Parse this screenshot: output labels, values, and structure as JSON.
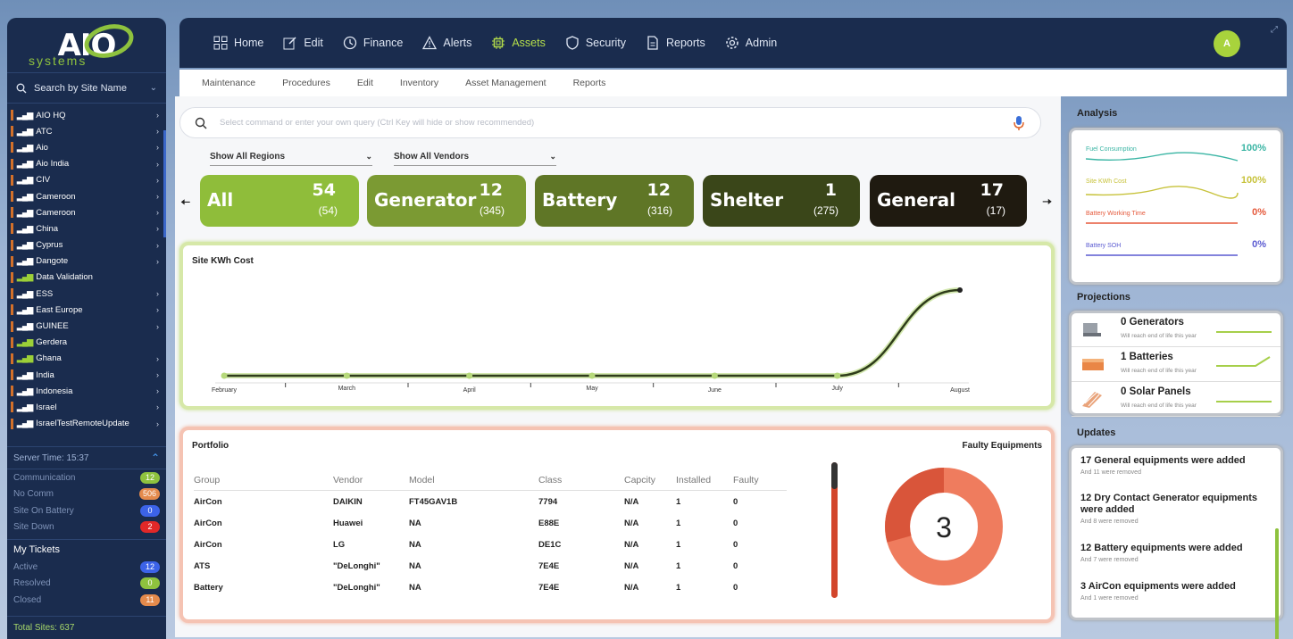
{
  "logo": {
    "brand": "AIO",
    "sub": "systems"
  },
  "sidebar": {
    "search_label": "Search by Site Name",
    "sites": [
      {
        "name": "AIO HQ",
        "arrow": true,
        "green": false
      },
      {
        "name": "ATC",
        "arrow": true,
        "green": false
      },
      {
        "name": "Aio",
        "arrow": true,
        "green": false
      },
      {
        "name": "Aio India",
        "arrow": true,
        "green": false
      },
      {
        "name": "CIV",
        "arrow": true,
        "green": false
      },
      {
        "name": "Cameroon",
        "arrow": true,
        "green": false
      },
      {
        "name": "Cameroon",
        "arrow": true,
        "green": false
      },
      {
        "name": "China",
        "arrow": true,
        "green": false
      },
      {
        "name": "Cyprus",
        "arrow": true,
        "green": false
      },
      {
        "name": "Dangote",
        "arrow": true,
        "green": false
      },
      {
        "name": "Data Validation",
        "arrow": false,
        "green": true
      },
      {
        "name": "ESS",
        "arrow": true,
        "green": false
      },
      {
        "name": "East Europe",
        "arrow": true,
        "green": false
      },
      {
        "name": "GUINEE",
        "arrow": true,
        "green": false
      },
      {
        "name": "Gerdera",
        "arrow": false,
        "green": true
      },
      {
        "name": "Ghana",
        "arrow": true,
        "green": true
      },
      {
        "name": "India",
        "arrow": true,
        "green": false
      },
      {
        "name": "Indonesia",
        "arrow": true,
        "green": false
      },
      {
        "name": "Israel",
        "arrow": true,
        "green": false
      },
      {
        "name": "IsraelTestRemoteUpdate",
        "arrow": true,
        "green": false
      }
    ],
    "server_time": "Server Time: 15:37",
    "stats": [
      {
        "label": "Communication",
        "value": "12",
        "color": "green"
      },
      {
        "label": "No Comm",
        "value": "506",
        "color": "orange"
      },
      {
        "label": "Site On Battery",
        "value": "0",
        "color": "blue"
      },
      {
        "label": "Site Down",
        "value": "2",
        "color": "red"
      }
    ],
    "tickets_heading": "My Tickets",
    "tickets": [
      {
        "label": "Active",
        "value": "12",
        "color": "blue"
      },
      {
        "label": "Resolved",
        "value": "0",
        "color": "green"
      },
      {
        "label": "Closed",
        "value": "11",
        "color": "orange"
      }
    ],
    "total_sites": "Total Sites: 637"
  },
  "nav": {
    "items": [
      {
        "label": "Home",
        "icon": "grid-icon"
      },
      {
        "label": "Edit",
        "icon": "edit-icon"
      },
      {
        "label": "Finance",
        "icon": "clock-icon"
      },
      {
        "label": "Alerts",
        "icon": "warning-icon"
      },
      {
        "label": "Assets",
        "icon": "chip-icon",
        "active": true
      },
      {
        "label": "Security",
        "icon": "shield-icon"
      },
      {
        "label": "Reports",
        "icon": "document-icon"
      },
      {
        "label": "Admin",
        "icon": "gear-icon"
      }
    ],
    "avatar": "A",
    "subtabs": [
      "Maintenance",
      "Procedures",
      "Edit",
      "Inventory",
      "Asset Management",
      "Reports"
    ]
  },
  "command": {
    "placeholder": "Select command or enter your own query (Ctrl Key will hide or show recommended)"
  },
  "filters": {
    "regions": "Show All Regions",
    "vendors": "Show All Vendors"
  },
  "cards": [
    {
      "name": "All",
      "count": "54",
      "sub": "(54)",
      "color": "#8fbd3a"
    },
    {
      "name": "Generator",
      "count": "12",
      "sub": "(345)",
      "color": "#7b9a33"
    },
    {
      "name": "Battery",
      "count": "12",
      "sub": "(316)",
      "color": "#5f7626"
    },
    {
      "name": "Shelter",
      "count": "1",
      "sub": "(275)",
      "color": "#3a4619"
    },
    {
      "name": "General",
      "count": "17",
      "sub": "(17)",
      "color": "#1f1a10"
    }
  ],
  "chart": {
    "title": "Site KWh Cost",
    "x_labels": [
      "February",
      "March",
      "April",
      "May",
      "June",
      "July",
      "August"
    ]
  },
  "chart_data": {
    "type": "line",
    "title": "Site KWh Cost",
    "categories": [
      "February",
      "March",
      "April",
      "May",
      "June",
      "July",
      "August"
    ],
    "values": [
      0,
      0,
      0,
      0,
      0,
      0,
      100
    ],
    "ylim": [
      0,
      100
    ]
  },
  "portfolio": {
    "title": "Portfolio",
    "faulty_title": "Faulty Equipments",
    "columns": [
      "Group",
      "Vendor",
      "Model",
      "Class",
      "Capcity",
      "Installed",
      "Faulty"
    ],
    "rows": [
      [
        "AirCon",
        "DAIKIN",
        "FT45GAV1B",
        "7794",
        "N/A",
        "1",
        "0"
      ],
      [
        "AirCon",
        "Huawei",
        "NA",
        "E88E",
        "N/A",
        "1",
        "0"
      ],
      [
        "AirCon",
        "LG",
        "NA",
        "DE1C",
        "N/A",
        "1",
        "0"
      ],
      [
        "ATS",
        "\"DeLonghi\"",
        "NA",
        "7E4E",
        "N/A",
        "1",
        "0"
      ],
      [
        "Battery",
        "\"DeLonghi\"",
        "NA",
        "7E4E",
        "N/A",
        "1",
        "0"
      ]
    ],
    "donut_value": "3"
  },
  "analysis": {
    "title": "Analysis",
    "rows": [
      {
        "label": "Fuel Consumption",
        "value": "100%",
        "color": "#3ab5a4"
      },
      {
        "label": "Site KWh Cost",
        "value": "100%",
        "color": "#c7c23a"
      },
      {
        "label": "Battery Working Time",
        "value": "0%",
        "color": "#e5593b"
      },
      {
        "label": "Battery SOH",
        "value": "0%",
        "color": "#5a5ad1"
      }
    ]
  },
  "projections": {
    "title": "Projections",
    "rows": [
      {
        "name": "0 Generators",
        "sub": "Will reach end of life this year"
      },
      {
        "name": "1 Batteries",
        "sub": "Will reach end of life this year"
      },
      {
        "name": "0 Solar Panels",
        "sub": "Will reach end of life this year"
      }
    ]
  },
  "updates": {
    "title": "Updates",
    "items": [
      {
        "title": "17 General equipments were added",
        "sub": "And 11 were removed"
      },
      {
        "title": "12 Dry Contact Generator equipments were added",
        "sub": "And 8 were removed"
      },
      {
        "title": "12 Battery equipments were added",
        "sub": "And 7 were removed"
      },
      {
        "title": "3 AirCon equipments were added",
        "sub": "And 1 were removed"
      }
    ]
  }
}
